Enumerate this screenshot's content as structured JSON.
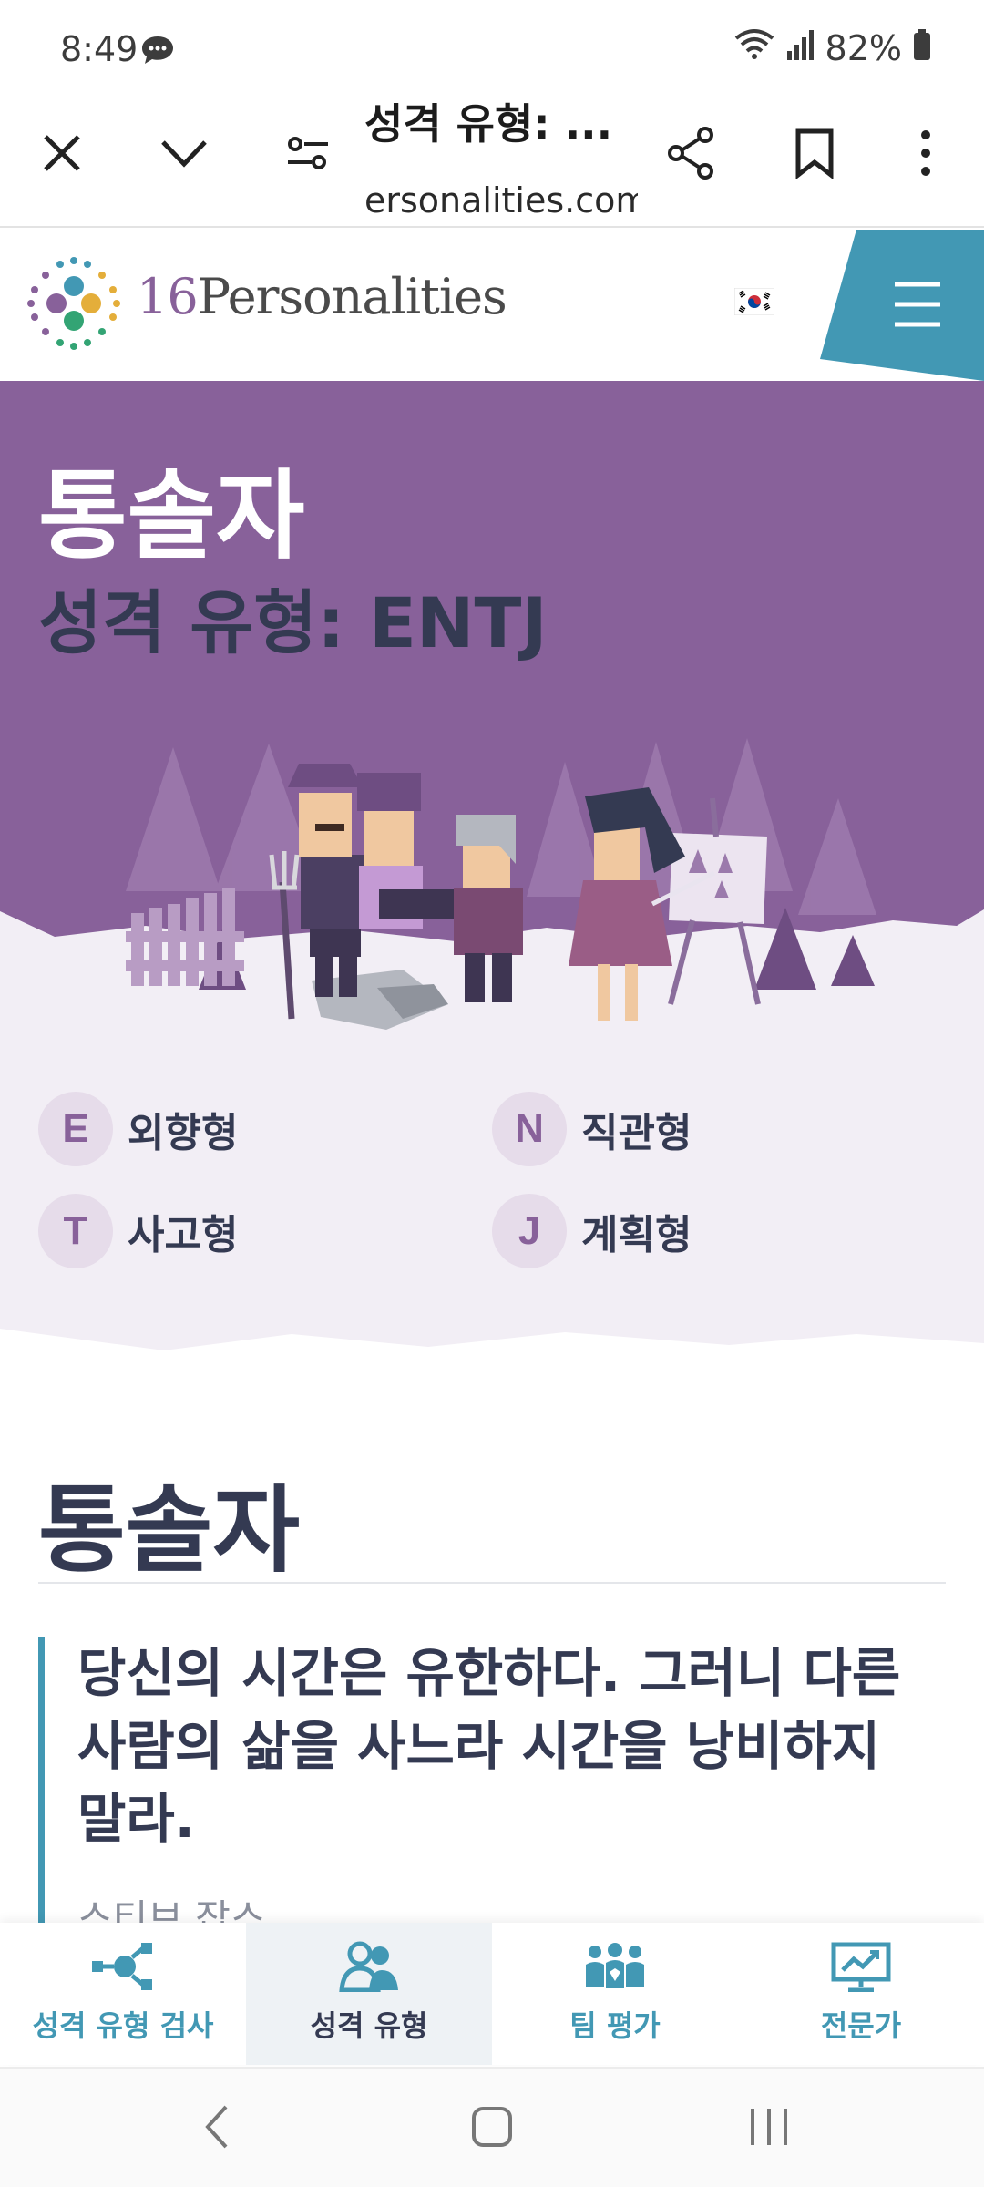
{
  "status": {
    "time": "8:49",
    "battery": "82%"
  },
  "browser": {
    "title": "성격 유형: ...",
    "url": "ersonalities.com"
  },
  "header": {
    "logo_num": "16",
    "logo_text": "Personalities"
  },
  "hero": {
    "type_name": "통솔자",
    "subtitle": "성격 유형: ENTJ",
    "traits": [
      {
        "letter": "E",
        "label": "외향형"
      },
      {
        "letter": "N",
        "label": "직관형"
      },
      {
        "letter": "T",
        "label": "사고형"
      },
      {
        "letter": "J",
        "label": "계획형"
      }
    ]
  },
  "article": {
    "title": "통솔자",
    "quote_lines": [
      "당신의 시간은 유한하다. 그러니 다른",
      "사람의 삶을 사느라 시간을 낭비하지",
      "말라."
    ],
    "quote_author": "스티브 잡스"
  },
  "bottom_nav": [
    {
      "label": "성격 유형 검사",
      "icon": "network-icon"
    },
    {
      "label": "성격 유형",
      "icon": "people-icon"
    },
    {
      "label": "팀 평가",
      "icon": "team-icon"
    },
    {
      "label": "전문가",
      "icon": "presentation-icon"
    }
  ],
  "colors": {
    "purple": "#88619a",
    "teal": "#4298b4",
    "dark": "#343a52"
  }
}
